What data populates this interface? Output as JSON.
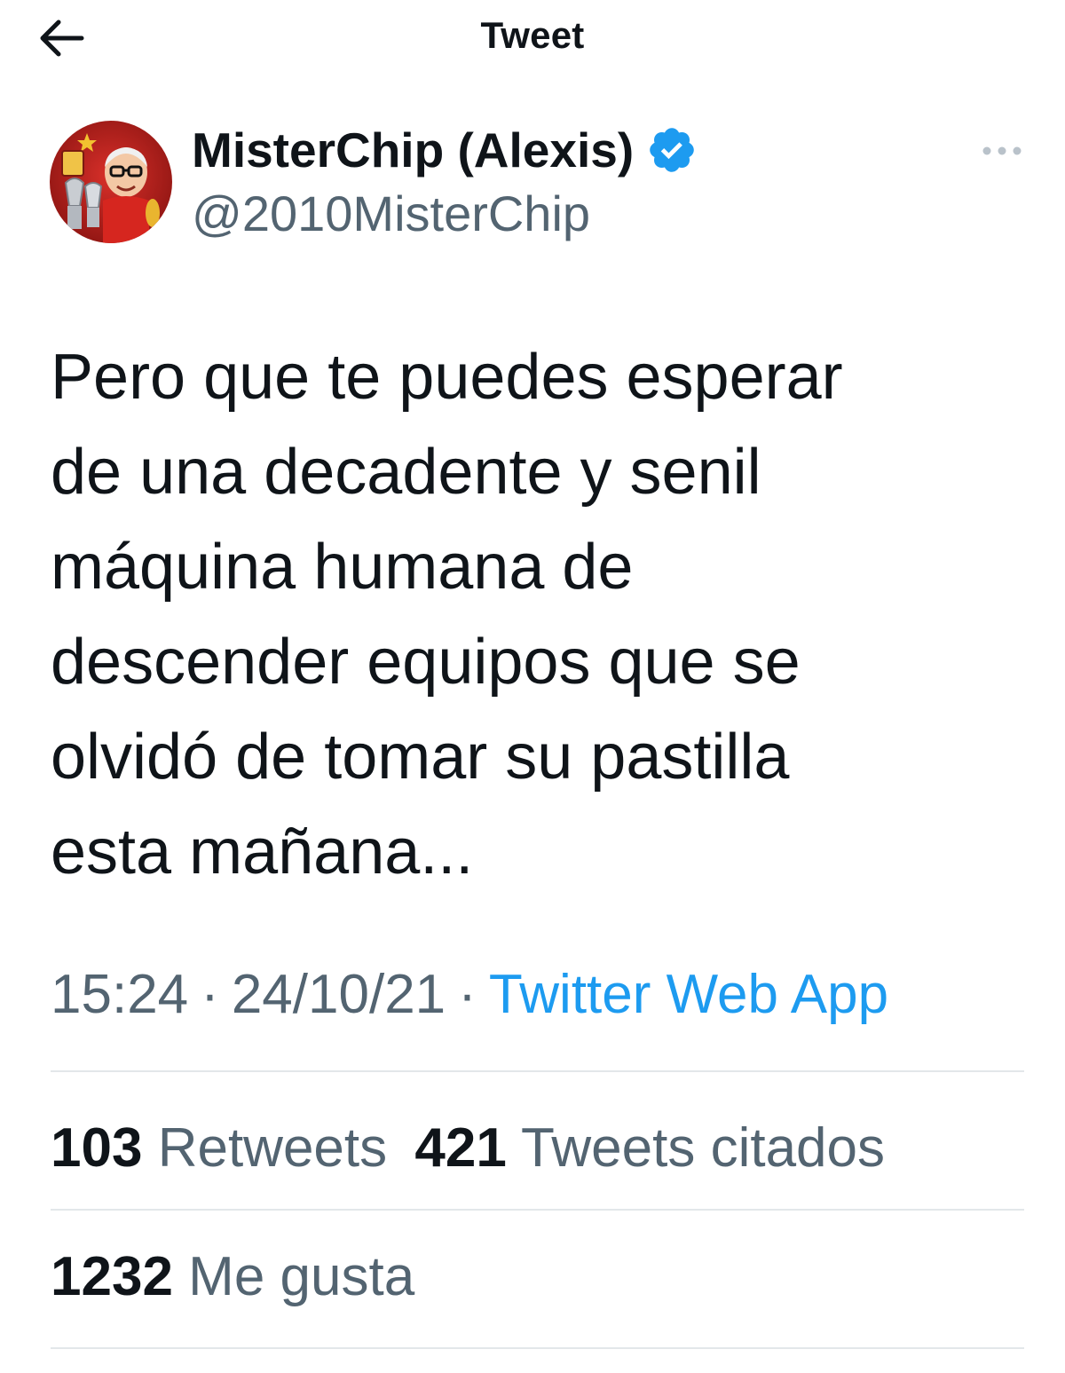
{
  "header": {
    "title": "Tweet",
    "back_icon": "arrow-left-icon"
  },
  "author": {
    "display_name": "MisterChip (Alexis)",
    "handle": "@2010MisterChip",
    "verified_icon": "verified-badge-icon",
    "verified_color": "#1d9bf0",
    "more_icon": "more-horizontal-icon"
  },
  "tweet": {
    "text": "Pero que te puedes esperar\nde una decadente y senil\nmáquina humana de\ndescender equipos que se\nolvidó de tomar su pastilla\nesta mañana...",
    "time": "15:24",
    "date": "24/10/21",
    "separator": "·",
    "source": "Twitter Web App"
  },
  "stats": {
    "retweets_count": "103",
    "retweets_label": "Retweets",
    "quotes_count": "421",
    "quotes_label": "Tweets citados",
    "likes_count": "1232",
    "likes_label": "Me gusta"
  },
  "colors": {
    "accent": "#1d9bf0",
    "text": "#0f1419",
    "secondary": "#536471",
    "divider": "#e3e7ea"
  }
}
